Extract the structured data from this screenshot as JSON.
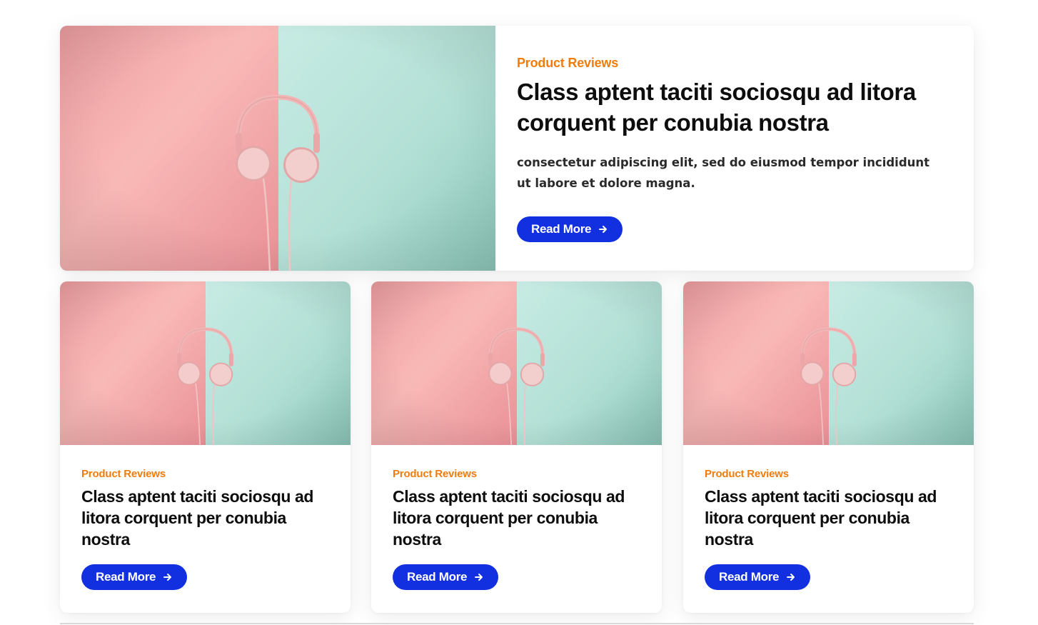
{
  "colors": {
    "accent": "#1230e0",
    "category": "#f07c0c",
    "pink": "#f6b3b2",
    "mint": "#bfe4dc"
  },
  "featured": {
    "category": "Product Reviews",
    "title": "Class aptent taciti sociosqu ad litora corquent per conubia nostra",
    "excerpt": "consectetur adipiscing elit, sed do eiusmod tempor incididunt ut labore et dolore magna.",
    "button_label": "Read More",
    "image_icon": "headphones-image"
  },
  "posts": [
    {
      "category": "Product Reviews",
      "title": "Class aptent taciti sociosqu ad litora corquent per conubia nostra",
      "button_label": "Read More",
      "image_icon": "headphones-image"
    },
    {
      "category": "Product Reviews",
      "title": "Class aptent taciti sociosqu ad litora corquent per conubia nostra",
      "button_label": "Read More",
      "image_icon": "headphones-image"
    },
    {
      "category": "Product Reviews",
      "title": "Class aptent taciti sociosqu ad litora corquent per conubia nostra",
      "button_label": "Read More",
      "image_icon": "headphones-image"
    }
  ]
}
